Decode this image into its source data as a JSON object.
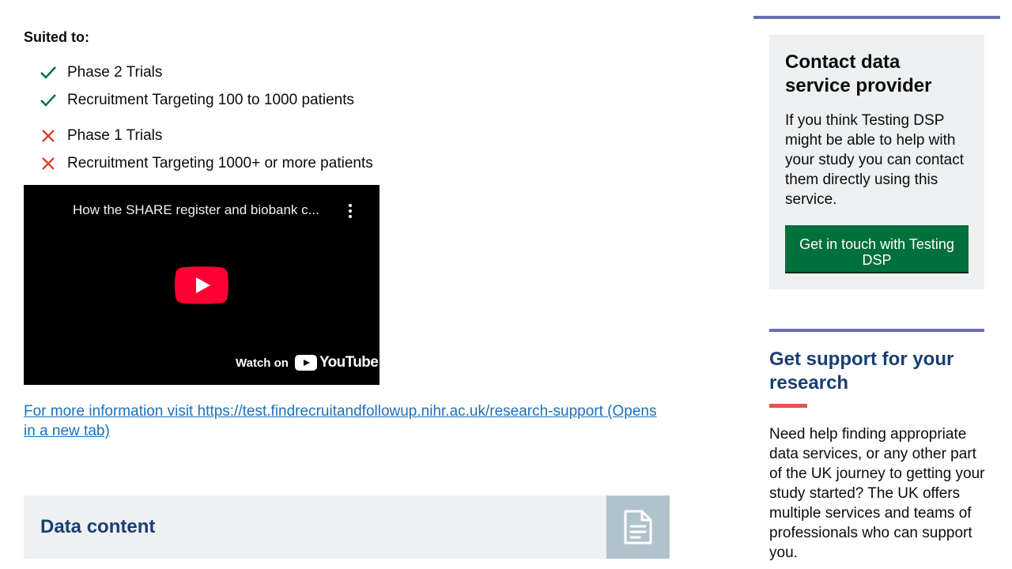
{
  "suited": {
    "heading": "Suited to:",
    "yes": [
      {
        "label": "Phase 2 Trials"
      },
      {
        "label": "Recruitment Targeting 100 to 1000 patients"
      }
    ],
    "no": [
      {
        "label": "Phase 1 Trials"
      },
      {
        "label": "Recruitment Targeting 1000+ or more patients"
      }
    ]
  },
  "video": {
    "title": "How the SHARE register and biobank c...",
    "watch_on": "Watch on",
    "youtube_logo_text": "YouTube"
  },
  "more_info_link": "For more information visit https://test.findrecruitandfollowup.nihr.ac.uk/research-support (Opens in a new tab)",
  "data_content": {
    "title": "Data content",
    "icon": "document-icon"
  },
  "contact": {
    "title": "Contact data service provider",
    "text": "If you think Testing DSP might be able to help with your study you can contact them directly using this service.",
    "button": "Get in touch with Testing DSP"
  },
  "support": {
    "title": "Get support for your research",
    "text": "Need help finding appropriate data services, or any other part of the UK journey to getting your study started? The UK offers multiple services and teams of professionals who can support you."
  },
  "colors": {
    "check": "#00703c",
    "cross": "#d4351c",
    "link": "#1d70b8",
    "heading_blue": "#193e72",
    "button_green": "#00703c",
    "rule_purple": "#6a6eb0",
    "accent_red": "#e0564d",
    "panel_grey": "#eff0f2",
    "icon_box": "#b0c3cc"
  }
}
